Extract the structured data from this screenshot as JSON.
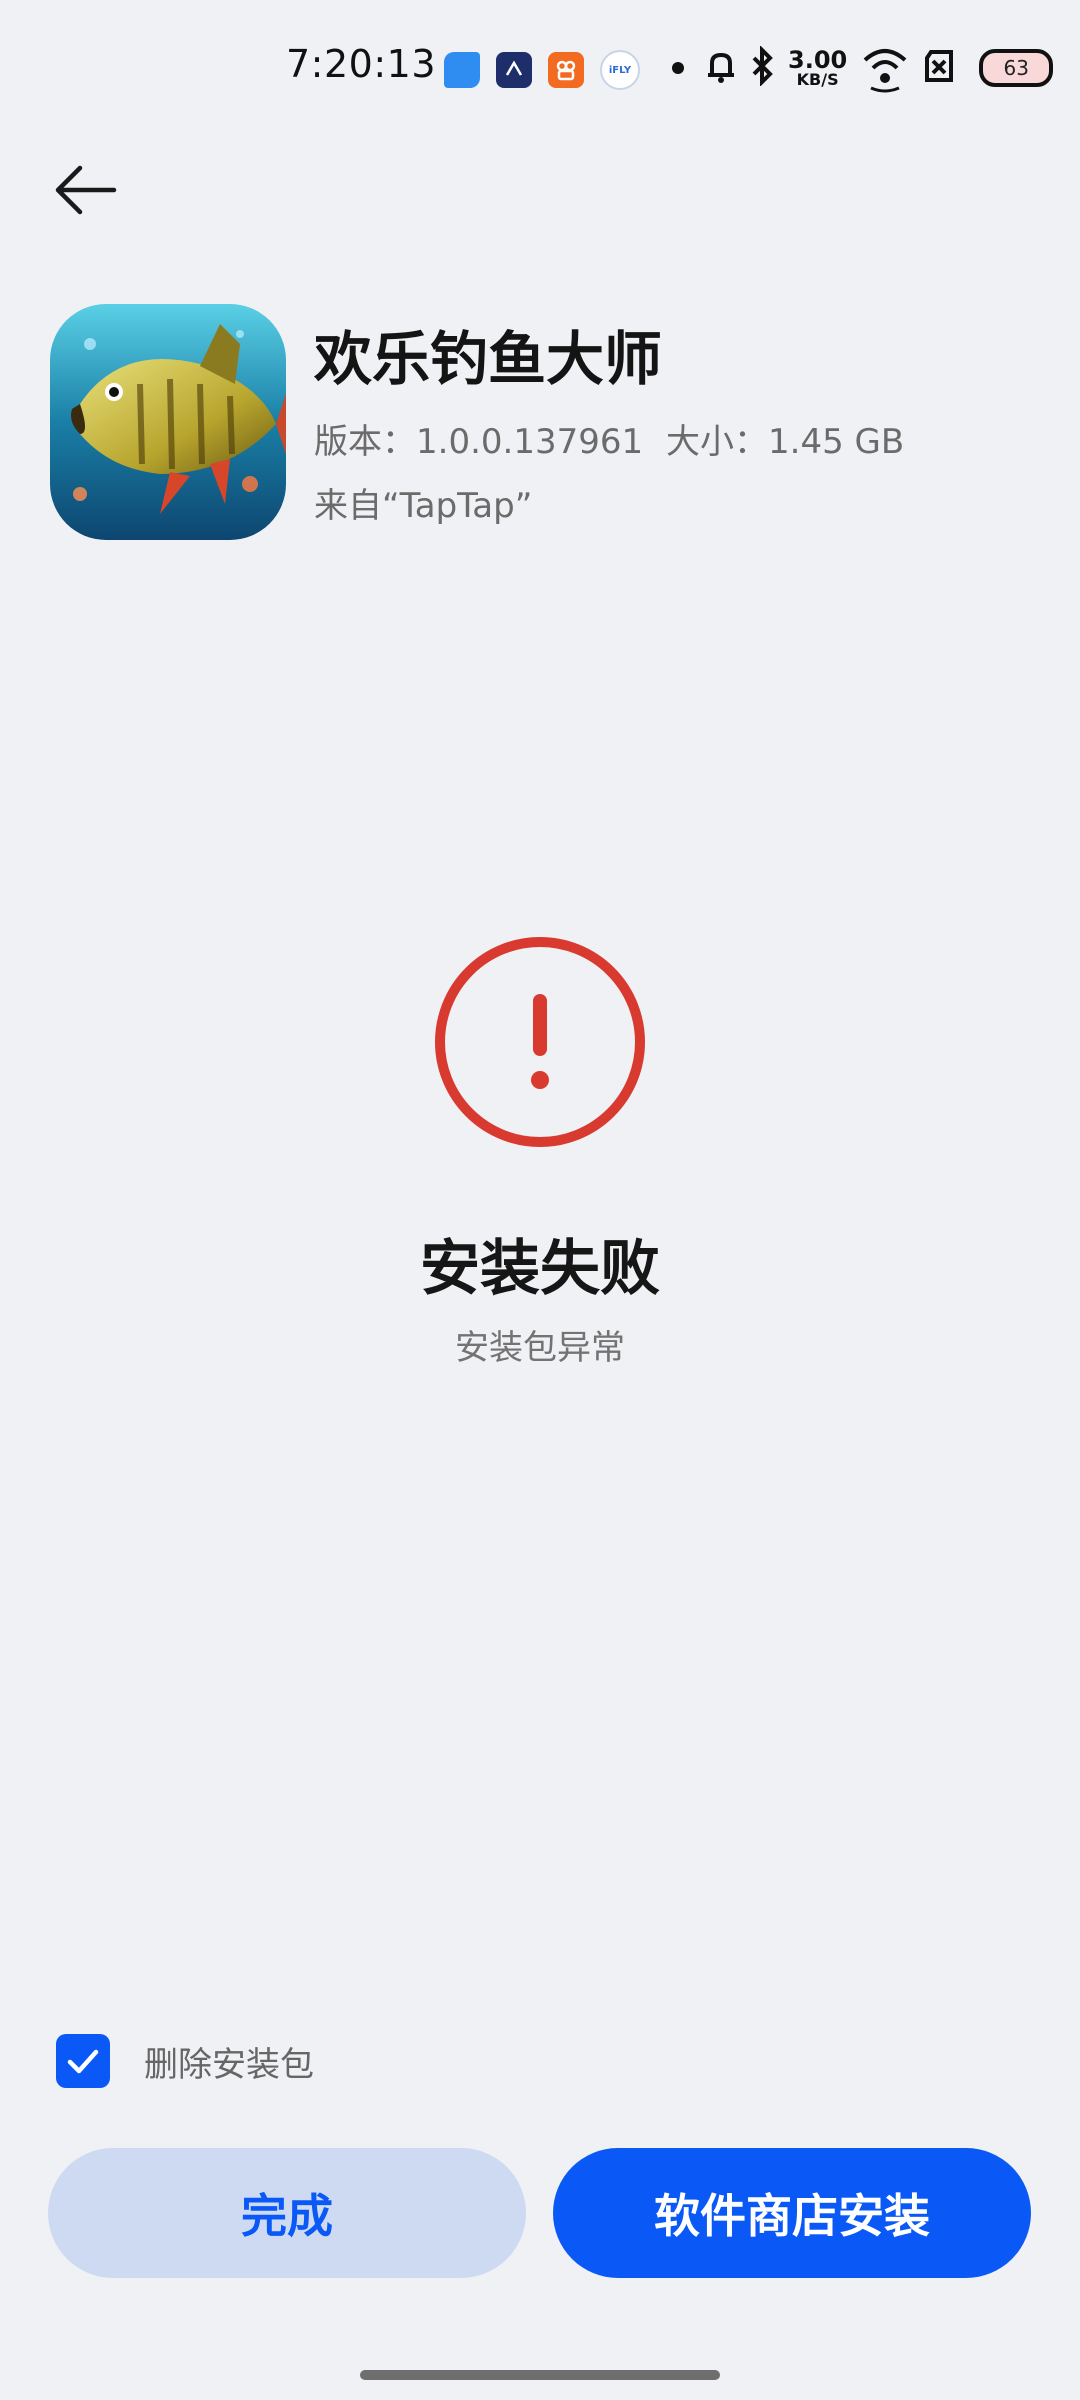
{
  "status_bar": {
    "time": "7:20:13",
    "net_speed_value": "3.00",
    "net_speed_unit": "KB/S",
    "battery_level": "63",
    "notification_icons": [
      "blue-leaf-app-icon",
      "fish-app-icon",
      "kuaishou-icon",
      "ifly-icon"
    ],
    "ifly_text": "iFLY"
  },
  "app": {
    "name": "欢乐钓鱼大师",
    "version_text": "版本：1.0.0.137961",
    "size_text": "大小：1.45 GB",
    "source_text": "来自“TapTap”"
  },
  "result": {
    "title": "安装失败",
    "subtitle": "安装包异常"
  },
  "options": {
    "delete_package_label": "删除安装包",
    "delete_package_checked": true
  },
  "buttons": {
    "done_label": "完成",
    "store_install_label": "软件商店安装"
  },
  "colors": {
    "accent": "#0a59f7",
    "error": "#d93a2f",
    "background": "#f0f1f4"
  }
}
